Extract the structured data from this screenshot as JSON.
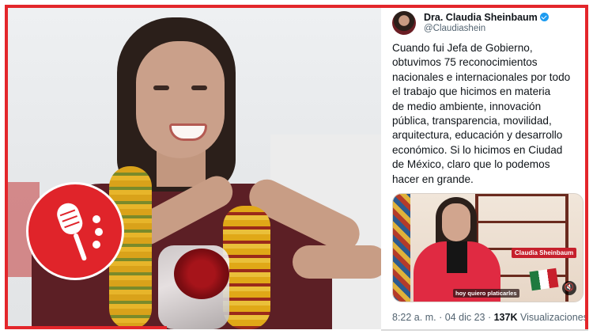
{
  "tweet": {
    "author_name": "Dra. Claudia Sheinbaum",
    "handle": "@Claudiashein",
    "verified_color": "#1d9bf0",
    "text_lines": [
      "Cuando fui Jefa de Gobierno,",
      "obtuvimos 75 reconocimientos",
      "nacionales e internacionales por todo",
      "el trabajo que hicimos en materia",
      "de medio ambiente, innovación",
      "pública, transparencia, movilidad,",
      "arquitectura, educación y desarrollo",
      "económico. Si lo hicimos en Ciudad",
      "de México, claro que lo podemos",
      "hacer en grande."
    ],
    "media": {
      "name_chip": "Claudia Sheinbaum",
      "caption": "hoy quiero platicarles",
      "mute_icon": "speaker-muted-icon"
    },
    "time": "8:22 a. m.",
    "separator": "·",
    "date": "04 dic 23",
    "views_count": "137K",
    "views_label": "Visualizaciones"
  },
  "badge": {
    "icon": "microphone-icon",
    "color": "#e0242a"
  },
  "frame": {
    "accent": "#e3262b"
  }
}
